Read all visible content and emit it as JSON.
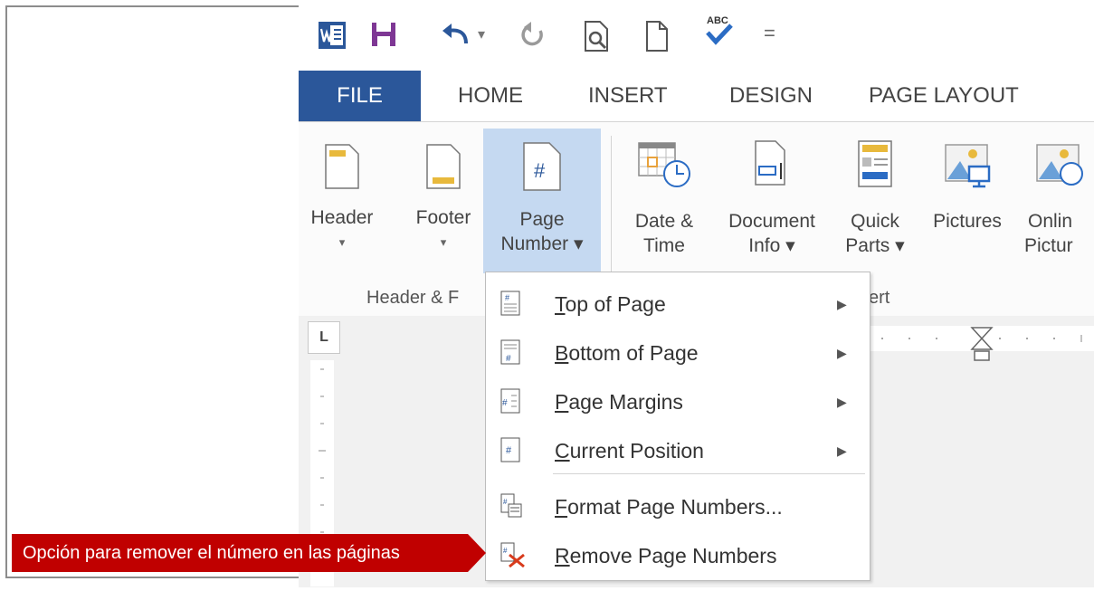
{
  "qat": {
    "undo_caret": "▾",
    "customize_caret": "="
  },
  "tabs": [
    {
      "label": "FILE"
    },
    {
      "label": "HOME"
    },
    {
      "label": "INSERT"
    },
    {
      "label": "DESIGN"
    },
    {
      "label": "PAGE LAYOUT"
    }
  ],
  "ribbon": {
    "buttons": [
      {
        "line1": "Header",
        "line2": "▾"
      },
      {
        "line1": "Footer",
        "line2": "▾"
      },
      {
        "line1": "Page",
        "line2": "Number ▾"
      },
      {
        "line1": "Date &",
        "line2": "Time"
      },
      {
        "line1": "Document",
        "line2": "Info ▾"
      },
      {
        "line1": "Quick",
        "line2": "Parts ▾"
      },
      {
        "line1": "Pictures",
        "line2": ""
      },
      {
        "line1": "Onlin",
        "line2": "Pictur"
      }
    ],
    "groups": [
      {
        "label": "Header & F"
      },
      {
        "label": "ert"
      }
    ]
  },
  "ruler": {
    "corner": "L"
  },
  "menu": {
    "items": [
      {
        "label": "Top of Page",
        "accel": "T",
        "rest": "op of Page",
        "has_submenu": true,
        "icon": "page-top-icon"
      },
      {
        "label": "Bottom of Page",
        "accel": "B",
        "rest": "ottom of Page",
        "has_submenu": true,
        "icon": "page-bottom-icon"
      },
      {
        "label": "Page Margins",
        "accel": "P",
        "rest": "age Margins",
        "has_submenu": true,
        "icon": "page-margins-icon"
      },
      {
        "label": "Current Position",
        "accel": "C",
        "rest": "urrent Position",
        "has_submenu": true,
        "icon": "current-position-icon"
      },
      {
        "label": "Format Page Numbers...",
        "accel": "F",
        "rest": "ormat Page Numbers...",
        "has_submenu": false,
        "icon": "format-page-numbers-icon"
      },
      {
        "label": "Remove Page Numbers",
        "accel": "R",
        "rest": "emove Page Numbers",
        "has_submenu": false,
        "icon": "remove-page-numbers-icon"
      }
    ],
    "submenu_arrow": "▶"
  },
  "callout": {
    "text": "Opción para remover el número en las páginas",
    "color": "#c00000"
  },
  "colors": {
    "file_tab": "#2b579a",
    "active_button": "#c5d9f1",
    "accent_gold": "#e8b93c"
  }
}
